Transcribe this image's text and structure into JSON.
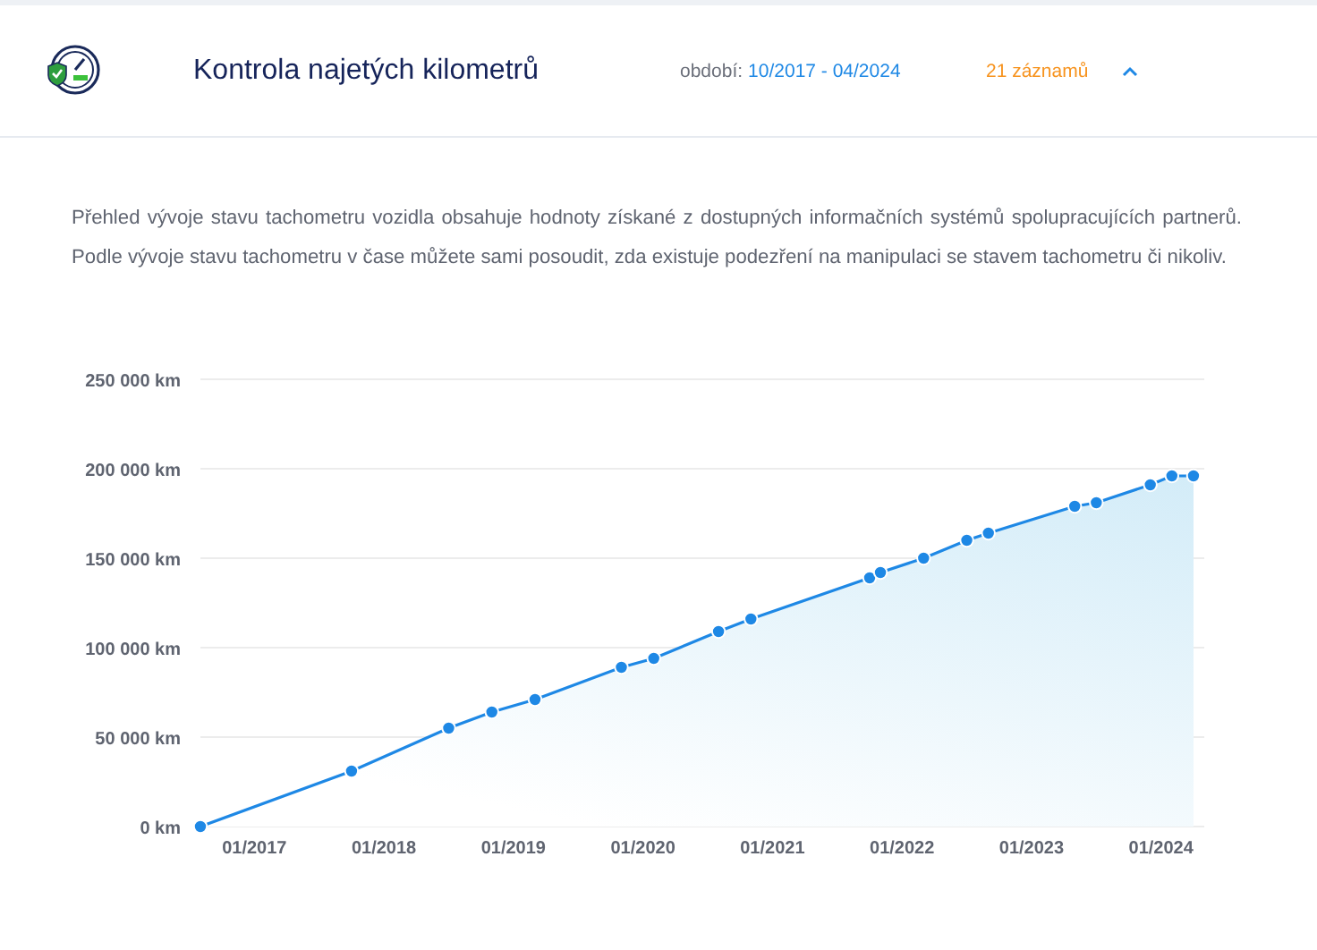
{
  "header": {
    "title": "Kontrola najetých kilometrů",
    "period_label": "období:",
    "period_value": "10/2017 - 04/2024",
    "records": "21 záznamů",
    "expanded": true
  },
  "description": "Přehled vývoje stavu tachometru vozidla obsahuje hodnoty získané z dostupných informačních systémů spolupracujících partnerů. Podle vývoje stavu tachometru v čase můžete sami posoudit, zda existuje podezření na manipulaci se stavem tachometru či nikoliv.",
  "chart_data": {
    "type": "area",
    "x": [
      "2016-08",
      "2017-10",
      "2018-07",
      "2018-11",
      "2019-03",
      "2019-11",
      "2020-02",
      "2020-08",
      "2020-11",
      "2021-10",
      "2021-11",
      "2022-03",
      "2022-07",
      "2022-09",
      "2023-05",
      "2023-07",
      "2023-12",
      "2024-02",
      "2024-04"
    ],
    "grid": true,
    "series": [
      {
        "color": "#1e88e5",
        "values": [
          0,
          31000,
          55000,
          64000,
          71000,
          89000,
          94000,
          109000,
          116000,
          139000,
          142000,
          150000,
          160000,
          164000,
          179000,
          181000,
          191000,
          196000,
          196000
        ]
      }
    ],
    "xlim": [
      "2016-08",
      "2024-05"
    ],
    "ylim": [
      0,
      250000
    ],
    "xticks": [
      {
        "value": "2017-01",
        "label": "01/2017"
      },
      {
        "value": "2018-01",
        "label": "01/2018"
      },
      {
        "value": "2019-01",
        "label": "01/2019"
      },
      {
        "value": "2020-01",
        "label": "01/2020"
      },
      {
        "value": "2021-01",
        "label": "01/2021"
      },
      {
        "value": "2022-01",
        "label": "01/2022"
      },
      {
        "value": "2023-01",
        "label": "01/2023"
      },
      {
        "value": "2024-01",
        "label": "01/2024"
      }
    ],
    "yticks": [
      {
        "value": 0,
        "label": "0 km"
      },
      {
        "value": 50000,
        "label": "50 000 km"
      },
      {
        "value": 100000,
        "label": "100 000 km"
      },
      {
        "value": 150000,
        "label": "150 000 km"
      },
      {
        "value": 200000,
        "label": "200 000 km"
      },
      {
        "value": 250000,
        "label": "250 000 km"
      }
    ]
  }
}
